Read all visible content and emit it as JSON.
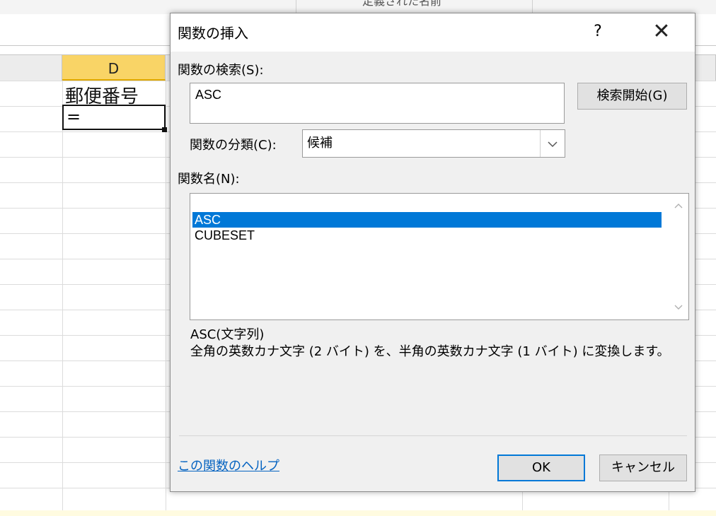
{
  "sheet": {
    "ribbon_label": "定義された名前",
    "selected_column": "D",
    "cell_d1": "郵便番号",
    "active_cell_value": "="
  },
  "dialog": {
    "title": "関数の挿入",
    "help_button": "?",
    "close_button": "✕",
    "search_label": "関数の検索(S):",
    "search_value": "ASC",
    "search_button": "検索開始(G)",
    "category_label": "関数の分類(C):",
    "category_value": "候補",
    "function_name_label": "関数名(N):",
    "functions": [
      "ASC",
      "CUBESET"
    ],
    "selected_function": "ASC",
    "syntax": "ASC(文字列)",
    "description": "全角の英数カナ文字 (2 バイト) を、半角の英数カナ文字 (1 バイト) に変換します。",
    "help_link": "この関数のヘルプ",
    "ok_button": "OK",
    "cancel_button": "キャンセル"
  },
  "icons": {
    "dropdown": "chevron-down-icon",
    "scroll_up": "chevron-up-icon",
    "scroll_down": "chevron-down-icon",
    "close": "close-icon"
  },
  "colors": {
    "selection": "#0078d7",
    "column_header_selected": "#f9d466",
    "link": "#0563c1"
  }
}
